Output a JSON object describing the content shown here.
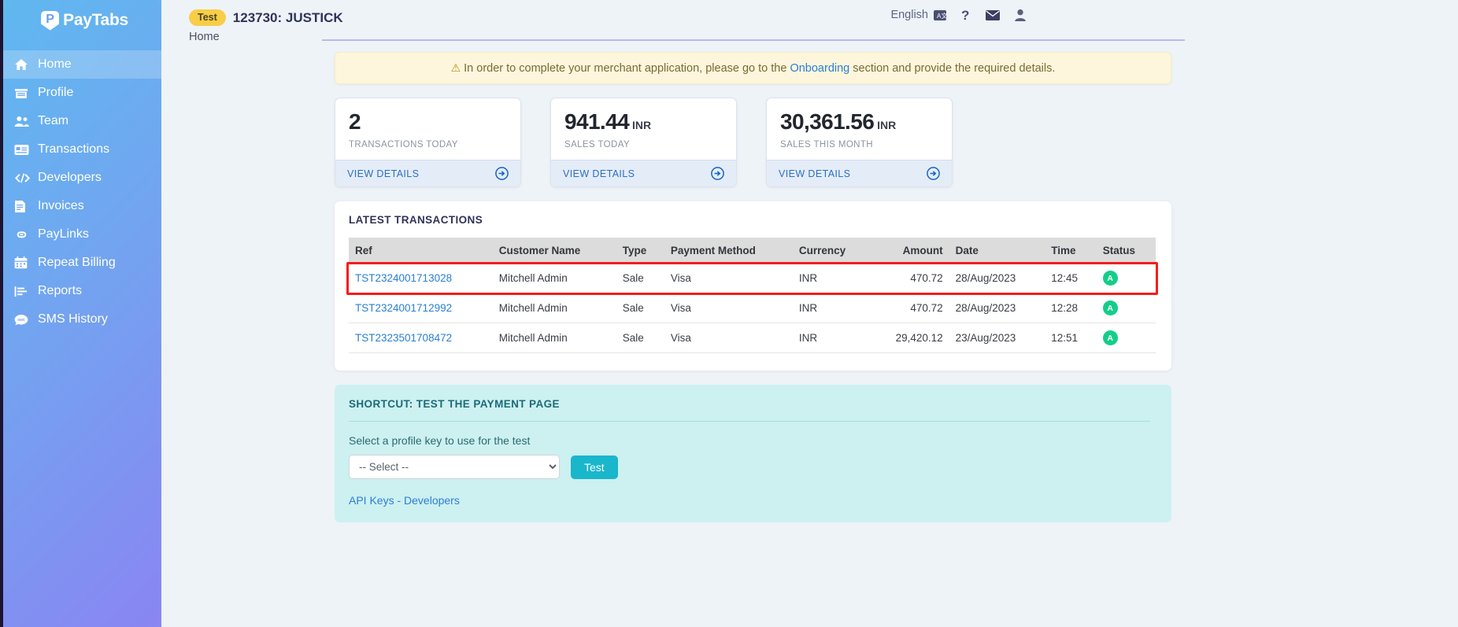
{
  "brand": {
    "name": "PayTabs",
    "mark_letter": "P"
  },
  "sidebar": {
    "items": [
      {
        "label": "Home",
        "icon": "home-icon",
        "active": true
      },
      {
        "label": "Profile",
        "icon": "store-icon",
        "active": false
      },
      {
        "label": "Team",
        "icon": "users-icon",
        "active": false
      },
      {
        "label": "Transactions",
        "icon": "card-icon",
        "active": false
      },
      {
        "label": "Developers",
        "icon": "code-icon",
        "active": false
      },
      {
        "label": "Invoices",
        "icon": "invoice-icon",
        "active": false
      },
      {
        "label": "PayLinks",
        "icon": "link-icon",
        "active": false
      },
      {
        "label": "Repeat Billing",
        "icon": "calendar-icon",
        "active": false
      },
      {
        "label": "Reports",
        "icon": "chart-icon",
        "active": false
      },
      {
        "label": "SMS History",
        "icon": "sms-icon",
        "active": false
      }
    ]
  },
  "header": {
    "test_badge": "Test",
    "merchant_title": "123730: JUSTICK",
    "breadcrumb": "Home",
    "language": "English",
    "icons": [
      "translate-icon",
      "help-icon",
      "mail-icon",
      "user-icon"
    ]
  },
  "alert": {
    "text_before": "In order to complete your merchant application, please go to the",
    "link": "Onboarding",
    "text_after": "section and provide the required details."
  },
  "cards": [
    {
      "value": "2",
      "currency": "",
      "label": "TRANSACTIONS TODAY",
      "action": "VIEW DETAILS"
    },
    {
      "value": "941.44",
      "currency": "INR",
      "label": "SALES TODAY",
      "action": "VIEW DETAILS"
    },
    {
      "value": "30,361.56",
      "currency": "INR",
      "label": "SALES THIS MONTH",
      "action": "VIEW DETAILS"
    }
  ],
  "transactions": {
    "title": "LATEST TRANSACTIONS",
    "columns": [
      "Ref",
      "Customer Name",
      "Type",
      "Payment Method",
      "Currency",
      "Amount",
      "Date",
      "Time",
      "Status"
    ],
    "rows": [
      {
        "ref": "TST2324001713028",
        "customer": "Mitchell Admin",
        "type": "Sale",
        "method": "Visa",
        "currency": "INR",
        "amount": "470.72",
        "date": "28/Aug/2023",
        "time": "12:45",
        "status": "A",
        "highlighted": true
      },
      {
        "ref": "TST2324001712992",
        "customer": "Mitchell Admin",
        "type": "Sale",
        "method": "Visa",
        "currency": "INR",
        "amount": "470.72",
        "date": "28/Aug/2023",
        "time": "12:28",
        "status": "A",
        "highlighted": false
      },
      {
        "ref": "TST2323501708472",
        "customer": "Mitchell Admin",
        "type": "Sale",
        "method": "Visa",
        "currency": "INR",
        "amount": "29,420.12",
        "date": "23/Aug/2023",
        "time": "12:51",
        "status": "A",
        "highlighted": false
      }
    ]
  },
  "shortcut": {
    "title": "SHORTCUT: TEST THE PAYMENT PAGE",
    "label": "Select a profile key to use for the test",
    "select_value": "-- Select --",
    "select_options": [
      "-- Select --"
    ],
    "test_button": "Test",
    "link": "API Keys - Developers"
  },
  "colors": {
    "sidebar_from": "#5fb8f0",
    "sidebar_to": "#8a85f2",
    "accent_link": "#2a7fd4",
    "status_green": "#13ce89",
    "badge_yellow": "#f7ce46",
    "shortcut_bg": "#cdf0f0",
    "test_button": "#19b6cc",
    "highlight_box": "#f51d1d"
  }
}
